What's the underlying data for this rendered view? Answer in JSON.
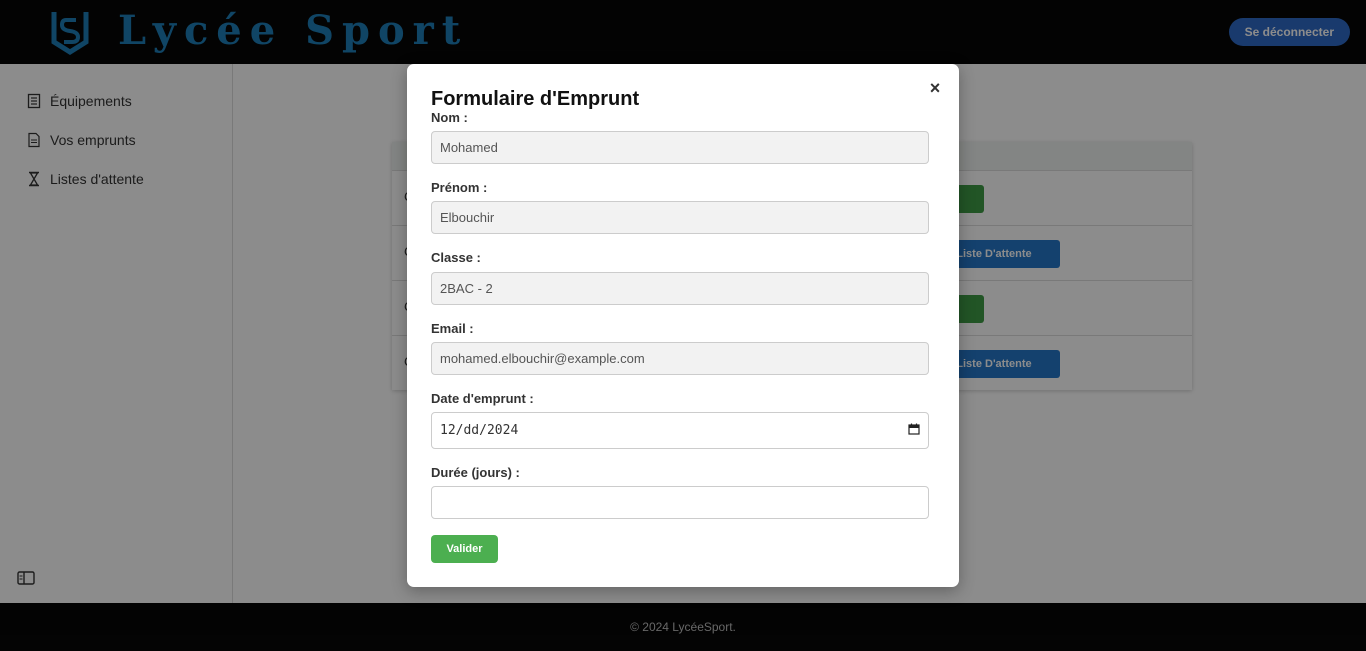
{
  "header": {
    "brand": "Lycée Sport",
    "logout_label": "Se déconnecter"
  },
  "sidebar": {
    "items": [
      {
        "label": "Équipements",
        "icon": "document-list-icon"
      },
      {
        "label": "Vos emprunts",
        "icon": "document-icon"
      },
      {
        "label": "Listes d'attente",
        "icon": "hourglass-icon"
      }
    ],
    "toggle_icon": "sidebar-toggle-icon"
  },
  "table": {
    "rows": [
      {
        "first_char": "C",
        "action": "er"
      },
      {
        "first_char": "C",
        "action": "La Liste D'attente"
      },
      {
        "first_char": "C",
        "action": "er"
      },
      {
        "first_char": "C",
        "action": "La Liste D'attente"
      }
    ]
  },
  "modal": {
    "title": "Formulaire d'Emprunt",
    "close_glyph": "×",
    "fields": {
      "nom": {
        "label": "Nom :",
        "value": "Mohamed"
      },
      "prenom": {
        "label": "Prénom :",
        "value": "Elbouchir"
      },
      "classe": {
        "label": "Classe :",
        "value": "2BAC - 2"
      },
      "email": {
        "label": "Email :",
        "value": "mohamed.elbouchir@example.com"
      },
      "date": {
        "label": "Date d'emprunt :",
        "value": "12/dd/2024"
      },
      "duree": {
        "label": "Durée (jours) :",
        "value": ""
      }
    },
    "submit_label": "Valider"
  },
  "footer": {
    "text": "© 2024 LycéeSport."
  },
  "colors": {
    "brand": "#1e7fb8",
    "logout": "#2f6bc6",
    "green": "#4caf50",
    "blue": "#2577c9",
    "header_bg": "#070707"
  }
}
